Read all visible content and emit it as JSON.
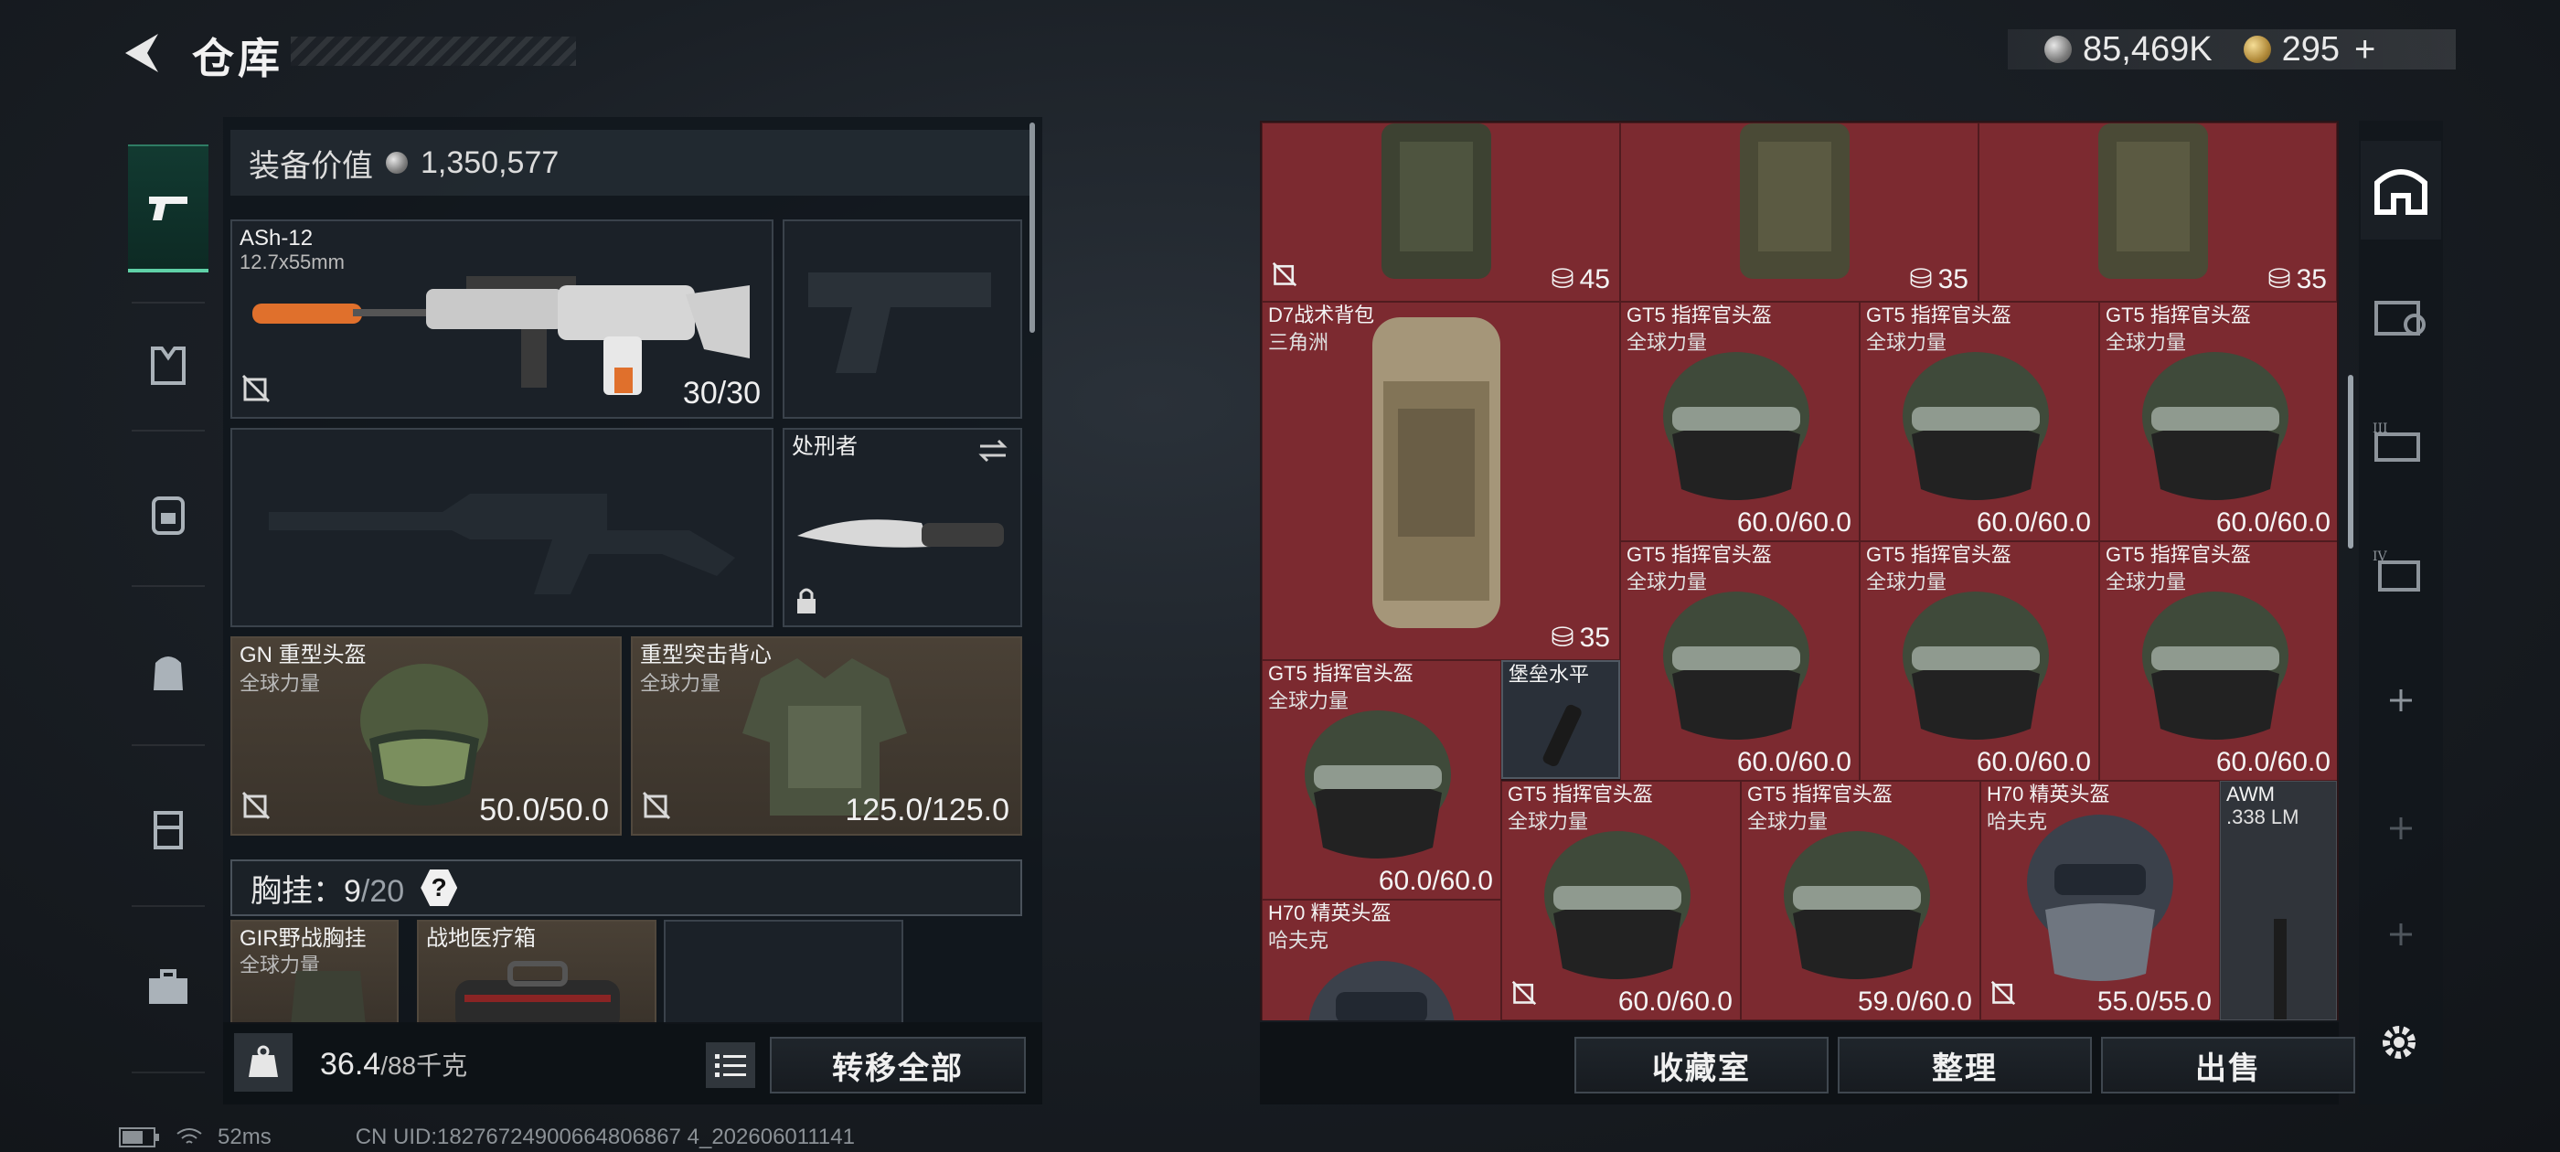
{
  "header": {
    "title": "仓库",
    "silver_amount": "85,469K",
    "gold_amount": "295",
    "gold_plus": "+"
  },
  "loadout": {
    "value_label": "装备价值",
    "value": "1,350,577",
    "primary_weapon": {
      "name": "ASh-12",
      "ammo": "12.7x55mm",
      "count": "30/30"
    },
    "melee": {
      "name": "处刑者"
    },
    "helmet": {
      "name": "GN 重型头盔",
      "faction": "全球力量",
      "durability": "50.0/50.0"
    },
    "armor": {
      "name": "重型突击背心",
      "faction": "全球力量",
      "durability": "125.0/125.0"
    },
    "chest_rig": {
      "label": "胸挂：",
      "used": "9",
      "cap": "/20",
      "help": "?"
    },
    "rig_items": [
      {
        "name": "GIR野战胸挂",
        "faction": "全球力量"
      },
      {
        "name": "战地医疗箱"
      }
    ],
    "weight": "36.4",
    "weight_cap": "/88千克",
    "transfer_all": "转移全部"
  },
  "stash": {
    "row0": [
      {
        "cap": "45"
      },
      {
        "cap": "35"
      },
      {
        "cap": "35"
      }
    ],
    "backpack": {
      "name": "D7战术背包",
      "faction": "三角洲",
      "cap": "35"
    },
    "helmets_row1": [
      {
        "name": "GT5 指挥官头盔",
        "faction": "全球力量",
        "durability": "60.0/60.0"
      },
      {
        "name": "GT5 指挥官头盔",
        "faction": "全球力量",
        "durability": "60.0/60.0"
      },
      {
        "name": "GT5 指挥官头盔",
        "faction": "全球力量",
        "durability": "60.0/60.0"
      }
    ],
    "helmets_row2": [
      {
        "name": "GT5 指挥官头盔",
        "faction": "全球力量",
        "durability": "60.0/60.0"
      },
      {
        "name": "GT5 指挥官头盔",
        "faction": "全球力量",
        "durability": "60.0/60.0"
      },
      {
        "name": "GT5 指挥官头盔",
        "faction": "全球力量",
        "durability": "60.0/60.0"
      }
    ],
    "helmet_left": {
      "name": "GT5 指挥官头盔",
      "faction": "全球力量",
      "durability": "60.0/60.0"
    },
    "item_small": {
      "name": "堡垒水平"
    },
    "helmets_row3": [
      {
        "name": "GT5 指挥官头盔",
        "faction": "全球力量",
        "durability": "60.0/60.0"
      },
      {
        "name": "GT5 指挥官头盔",
        "faction": "全球力量",
        "durability": "59.0/60.0"
      },
      {
        "name": "H70 精英头盔",
        "faction": "哈夫克",
        "durability": "55.0/55.0"
      }
    ],
    "awm": {
      "name": "AWM",
      "ammo": ".338 LM"
    },
    "h70_left": {
      "name": "H70 精英头盔",
      "faction": "哈夫克"
    },
    "buttons": {
      "collection": "收藏室",
      "sort": "整理",
      "sell": "出售"
    }
  },
  "status_bar": {
    "ping": "52ms",
    "uid": "CN UID:18276724900664806867 4_202606011141"
  },
  "colors": {
    "accent": "#5fd1a7",
    "stash_cell": "#7c2a30",
    "gear_slot": "#4a4136"
  }
}
